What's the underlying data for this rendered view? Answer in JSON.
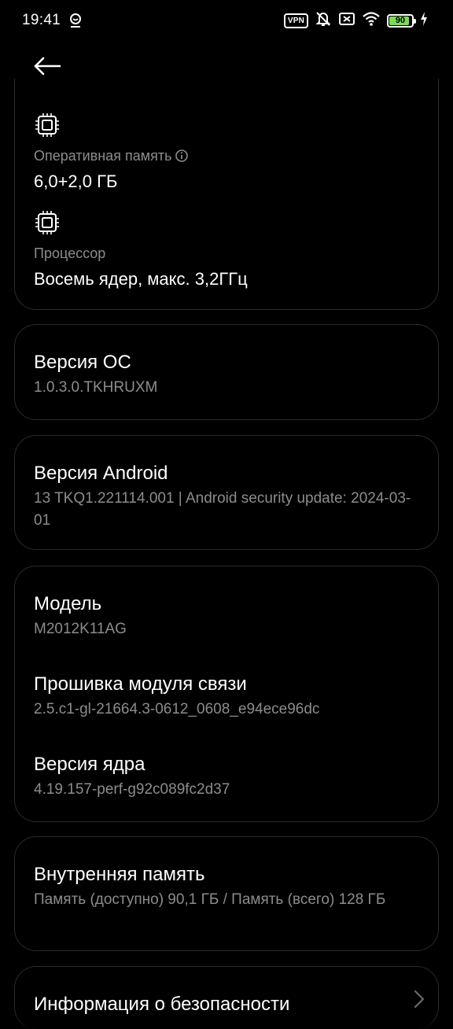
{
  "status_bar": {
    "time": "19:41",
    "vpn_label": "VPN",
    "battery_level": "90",
    "battery_fraction": 0.9,
    "battery_color": "#7ed957",
    "icons": [
      "notification-icon",
      "vpn-icon",
      "mute-icon",
      "sim-off-icon",
      "wifi-icon",
      "battery-icon",
      "charging-icon"
    ]
  },
  "header": {
    "back_icon": "back-arrow-icon"
  },
  "specs": {
    "ram_label": "Оперативная память",
    "ram_value": "6,0+2,0 ГБ",
    "cpu_label": "Процессор",
    "cpu_value": "Восемь ядер, макс. 3,2ГГц"
  },
  "os_version": {
    "title": "Версия ОС",
    "value": "1.0.3.0.TKHRUXM"
  },
  "android_version": {
    "title": "Версия Android",
    "value": "13 TKQ1.221114.001 | Android security update: 2024-03-01"
  },
  "device_info": {
    "model_title": "Модель",
    "model_value": "M2012K11AG",
    "baseband_title": "Прошивка модуля связи",
    "baseband_value": "2.5.c1-gl-21664.3-0612_0608_e94ece96dc",
    "kernel_title": "Версия ядра",
    "kernel_value": "4.19.157-perf-g92c089fc2d37"
  },
  "storage": {
    "title": "Внутренняя память",
    "value": "Память (доступно)  90,1 ГБ / Память (всего)  128 ГБ"
  },
  "security": {
    "title": "Информация о безопасности"
  }
}
